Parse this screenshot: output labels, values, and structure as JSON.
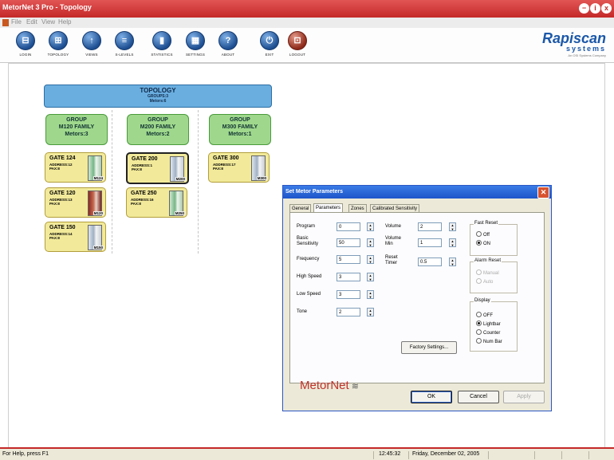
{
  "window": {
    "title": "MetorNet 3 Pro - Topology",
    "controls": {
      "minimize": "−",
      "help": "i",
      "close": "x"
    }
  },
  "menu": [
    "File",
    "Edit",
    "View",
    "Help"
  ],
  "toolbar": [
    {
      "label": "LOGIN",
      "glyph": "⊟"
    },
    {
      "label": "TOPOLOGY",
      "glyph": "⊞"
    },
    {
      "label": "VIEWS",
      "glyph": "↑"
    },
    {
      "label": "S-LEVELS",
      "glyph": "≡"
    },
    {
      "label": "STATISTICS",
      "glyph": "▮"
    },
    {
      "label": "SETTINGS",
      "glyph": "▦"
    },
    {
      "label": "ABOUT",
      "glyph": "?"
    },
    {
      "label": "EXIT",
      "glyph": "⏻"
    },
    {
      "label": "LOGOUT",
      "glyph": "⊡"
    }
  ],
  "logo": {
    "name": "Rapiscan",
    "sub": "systems",
    "tag": "An OSI Systems Company"
  },
  "topology": {
    "title": "TOPOLOGY",
    "groups_line": "GROUPS:3",
    "metors_line": "Metors:6"
  },
  "groups": [
    {
      "line1": "GROUP",
      "line2": "M120 FAMILY",
      "line3": "Metors:3"
    },
    {
      "line1": "GROUP",
      "line2": "M200 FAMILY",
      "line3": "Metors:2"
    },
    {
      "line1": "GROUP",
      "line2": "M300 FAMILY",
      "line3": "Metors:1"
    }
  ],
  "gates": [
    {
      "name": "GATE 124",
      "address": "ADDRESS:12",
      "pax": "PAX:8",
      "model": "M124"
    },
    {
      "name": "GATE 120",
      "address": "ADDRESS:13",
      "pax": "PAX:8",
      "model": "M120"
    },
    {
      "name": "GATE 150",
      "address": "ADDRESS:14",
      "pax": "PAX:8",
      "model": "M150"
    },
    {
      "name": "GATE 200",
      "address": "ADDRESS:1",
      "pax": "PAX:8",
      "model": "M200"
    },
    {
      "name": "GATE 250",
      "address": "ADDRESS:16",
      "pax": "PAX:8",
      "model": "M250"
    },
    {
      "name": "GATE 300",
      "address": "ADDRESS:17",
      "pax": "PAX:8",
      "model": "M300"
    }
  ],
  "dialog": {
    "title": "Set Metor Parameters",
    "close": "✕",
    "tabs": [
      "General",
      "Parameters",
      "Zones",
      "Calibrated Sensitivity"
    ],
    "active_tab": "Parameters",
    "fields_left": [
      {
        "label": "Program",
        "value": "0"
      },
      {
        "label": "Basic Sensitivity",
        "value": "50"
      },
      {
        "label": "Frequency",
        "value": "5"
      },
      {
        "label": "High Speed",
        "value": "3"
      },
      {
        "label": "Low Speed",
        "value": "3"
      },
      {
        "label": "Tone",
        "value": "2"
      }
    ],
    "fields_right": [
      {
        "label": "Volume",
        "value": "2"
      },
      {
        "label": "Volume Min",
        "value": "1"
      },
      {
        "label": "Reset Timer",
        "value": "0.5"
      }
    ],
    "spin": {
      "up": "▲",
      "down": "▼"
    },
    "fast_reset": {
      "label": "Fast Reset",
      "options": [
        "Off",
        "ON"
      ],
      "selected": "ON"
    },
    "alarm_reset": {
      "label": "Alarm Reset",
      "options": [
        "Manual",
        "Auto"
      ]
    },
    "display": {
      "label": "Display",
      "options": [
        "OFF",
        "Lightbar",
        "Counter",
        "Num Bar"
      ],
      "selected": "Lightbar"
    },
    "factory_button": "Factory Settings...",
    "brand": "MetorNet",
    "buttons": {
      "ok": "OK",
      "cancel": "Cancel",
      "apply": "Apply"
    }
  },
  "status": {
    "help": "For Help, press F1",
    "time": "12:45:32",
    "date": "Friday, December 02, 2005"
  }
}
